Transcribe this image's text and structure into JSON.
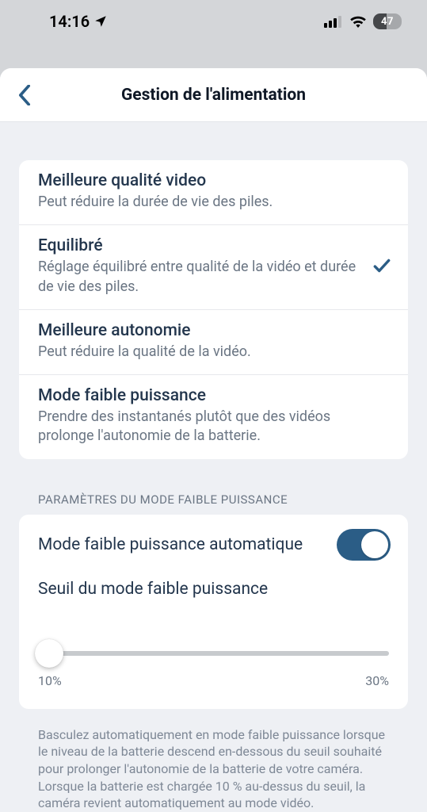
{
  "status": {
    "time": "14:16",
    "battery_level": "47"
  },
  "header": {
    "title": "Gestion de l'alimentation"
  },
  "options": [
    {
      "title": "Meilleure qualité video",
      "desc": "Peut réduire la durée de vie des piles.",
      "selected": false
    },
    {
      "title": "Equilibré",
      "desc": "Réglage équilibré entre qualité de la vidéo et durée de vie des piles.",
      "selected": true
    },
    {
      "title": "Meilleure autonomie",
      "desc": "Peut réduire la qualité de la vidéo.",
      "selected": false
    },
    {
      "title": "Mode faible puissance",
      "desc": "Prendre des instantanés plutôt que des vidéos prolonge l'autonomie de la batterie.",
      "selected": false
    }
  ],
  "section_label": "PARAMÈTRES DU MODE FAIBLE PUISSANCE",
  "auto_low_power": {
    "label": "Mode faible puissance automatique",
    "enabled": true
  },
  "threshold": {
    "label": "Seuil du mode faible puissance",
    "min_label": "10%",
    "max_label": "30%",
    "value_pct": 0
  },
  "footnote": "Basculez automatiquement en mode faible puissance lorsque le niveau de la batterie descend en-dessous du seuil souhaité pour prolonger l'autonomie de la batterie de votre caméra. Lorsque la batterie est chargée 10 % au-dessus du seuil, la caméra revient automatiquement au mode vidéo."
}
